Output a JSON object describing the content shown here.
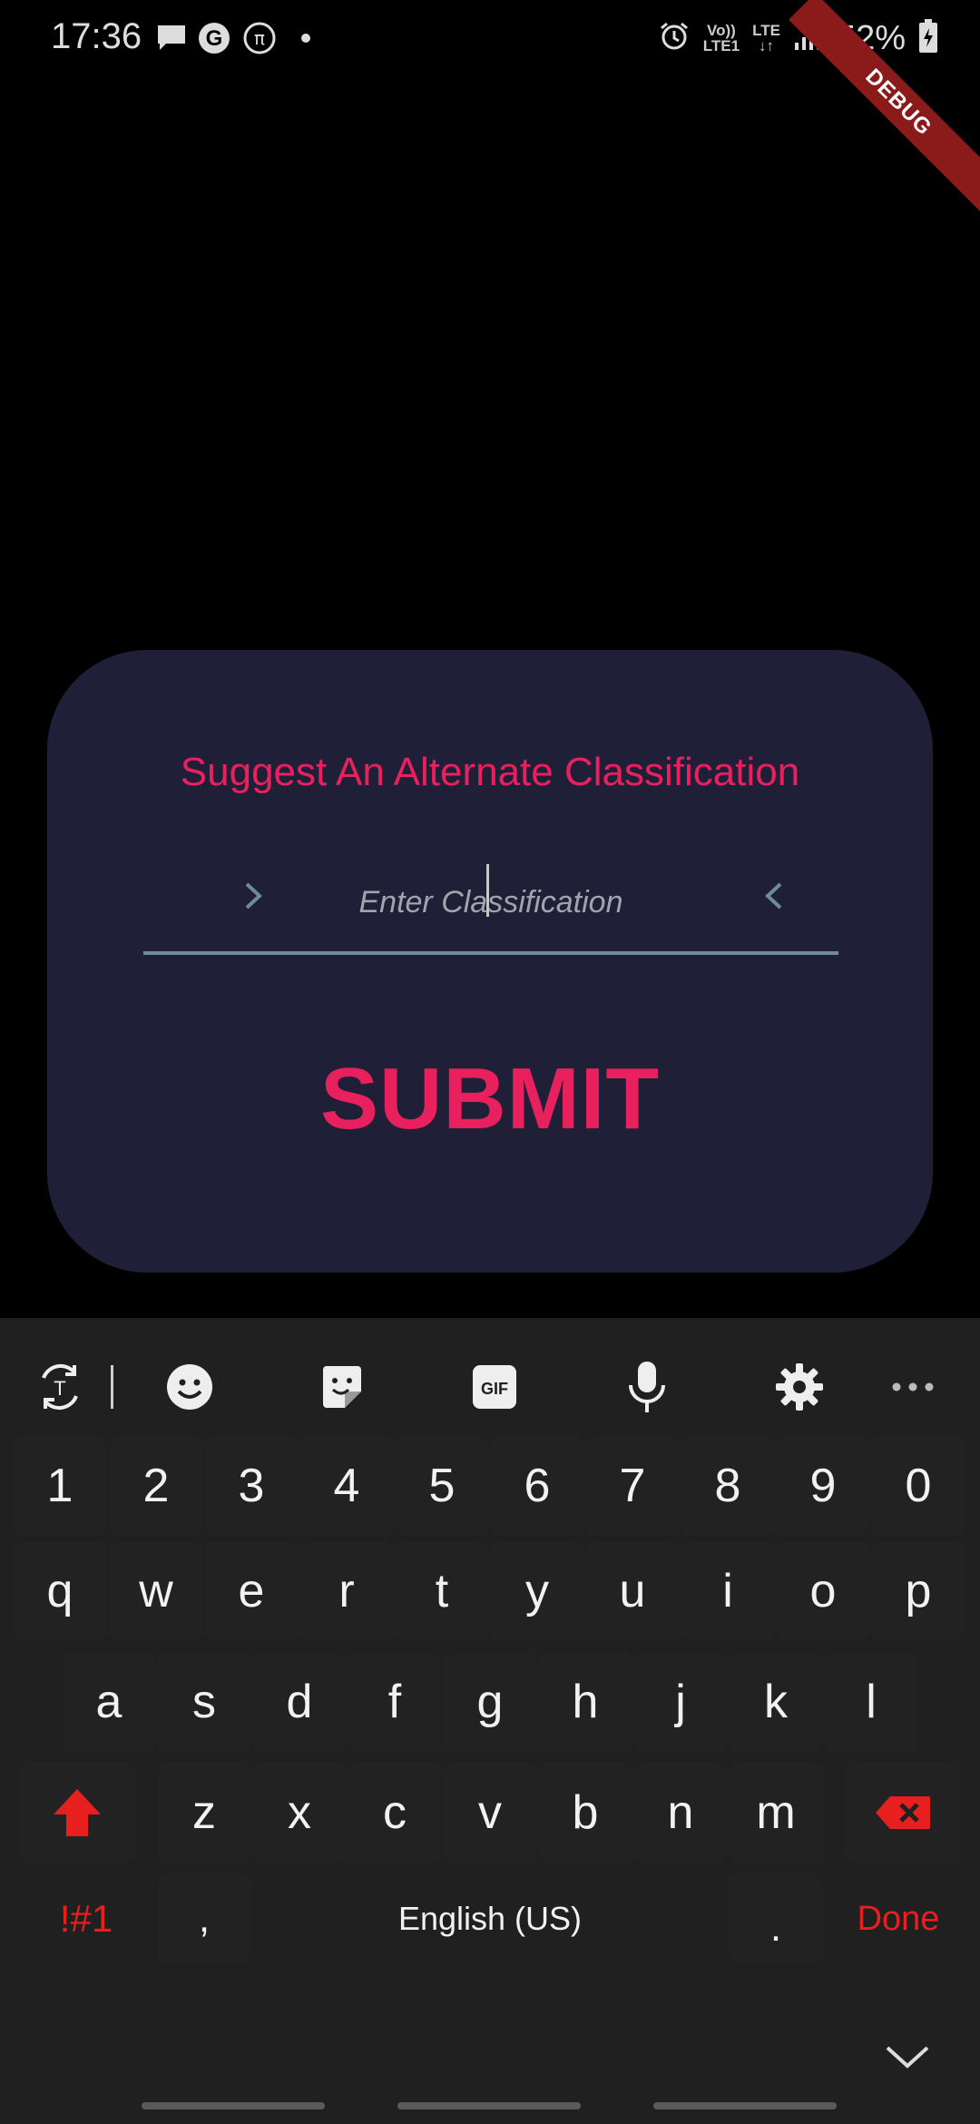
{
  "status_bar": {
    "time": "17:36",
    "battery": "52%",
    "icons": [
      "message-icon",
      "google-icon",
      "pi-icon",
      "dot-icon",
      "alarm-icon",
      "volte-icon",
      "lte-icon",
      "signal-icon",
      "battery-charging-icon"
    ],
    "volte_top": "Vo))",
    "volte_bottom": "LTE1",
    "lte_label": "LTE"
  },
  "debug_banner": "DEBUG",
  "dialog": {
    "title": "Suggest An Alternate Classification",
    "input_placeholder": "Enter Classification",
    "input_value": "",
    "submit_label": "SUBMIT"
  },
  "keyboard": {
    "toolbar": [
      "translate-icon",
      "emoji-icon",
      "sticker-icon",
      "gif-icon",
      "mic-icon",
      "settings-icon",
      "more-icon"
    ],
    "gif_label": "GIF",
    "number_row": [
      "1",
      "2",
      "3",
      "4",
      "5",
      "6",
      "7",
      "8",
      "9",
      "0"
    ],
    "row1": [
      "q",
      "w",
      "e",
      "r",
      "t",
      "y",
      "u",
      "i",
      "o",
      "p"
    ],
    "row2": [
      "a",
      "s",
      "d",
      "f",
      "g",
      "h",
      "j",
      "k",
      "l"
    ],
    "row3": [
      "z",
      "x",
      "c",
      "v",
      "b",
      "n",
      "m"
    ],
    "symbols_label": "!#1",
    "comma": ",",
    "space_label": "English (US)",
    "period": ".",
    "done_label": "Done"
  },
  "colors": {
    "accent": "#e8205e",
    "card_bg": "#1f1f38",
    "keyboard_bg": "#202020",
    "keyboard_accent": "#e81f1f"
  }
}
